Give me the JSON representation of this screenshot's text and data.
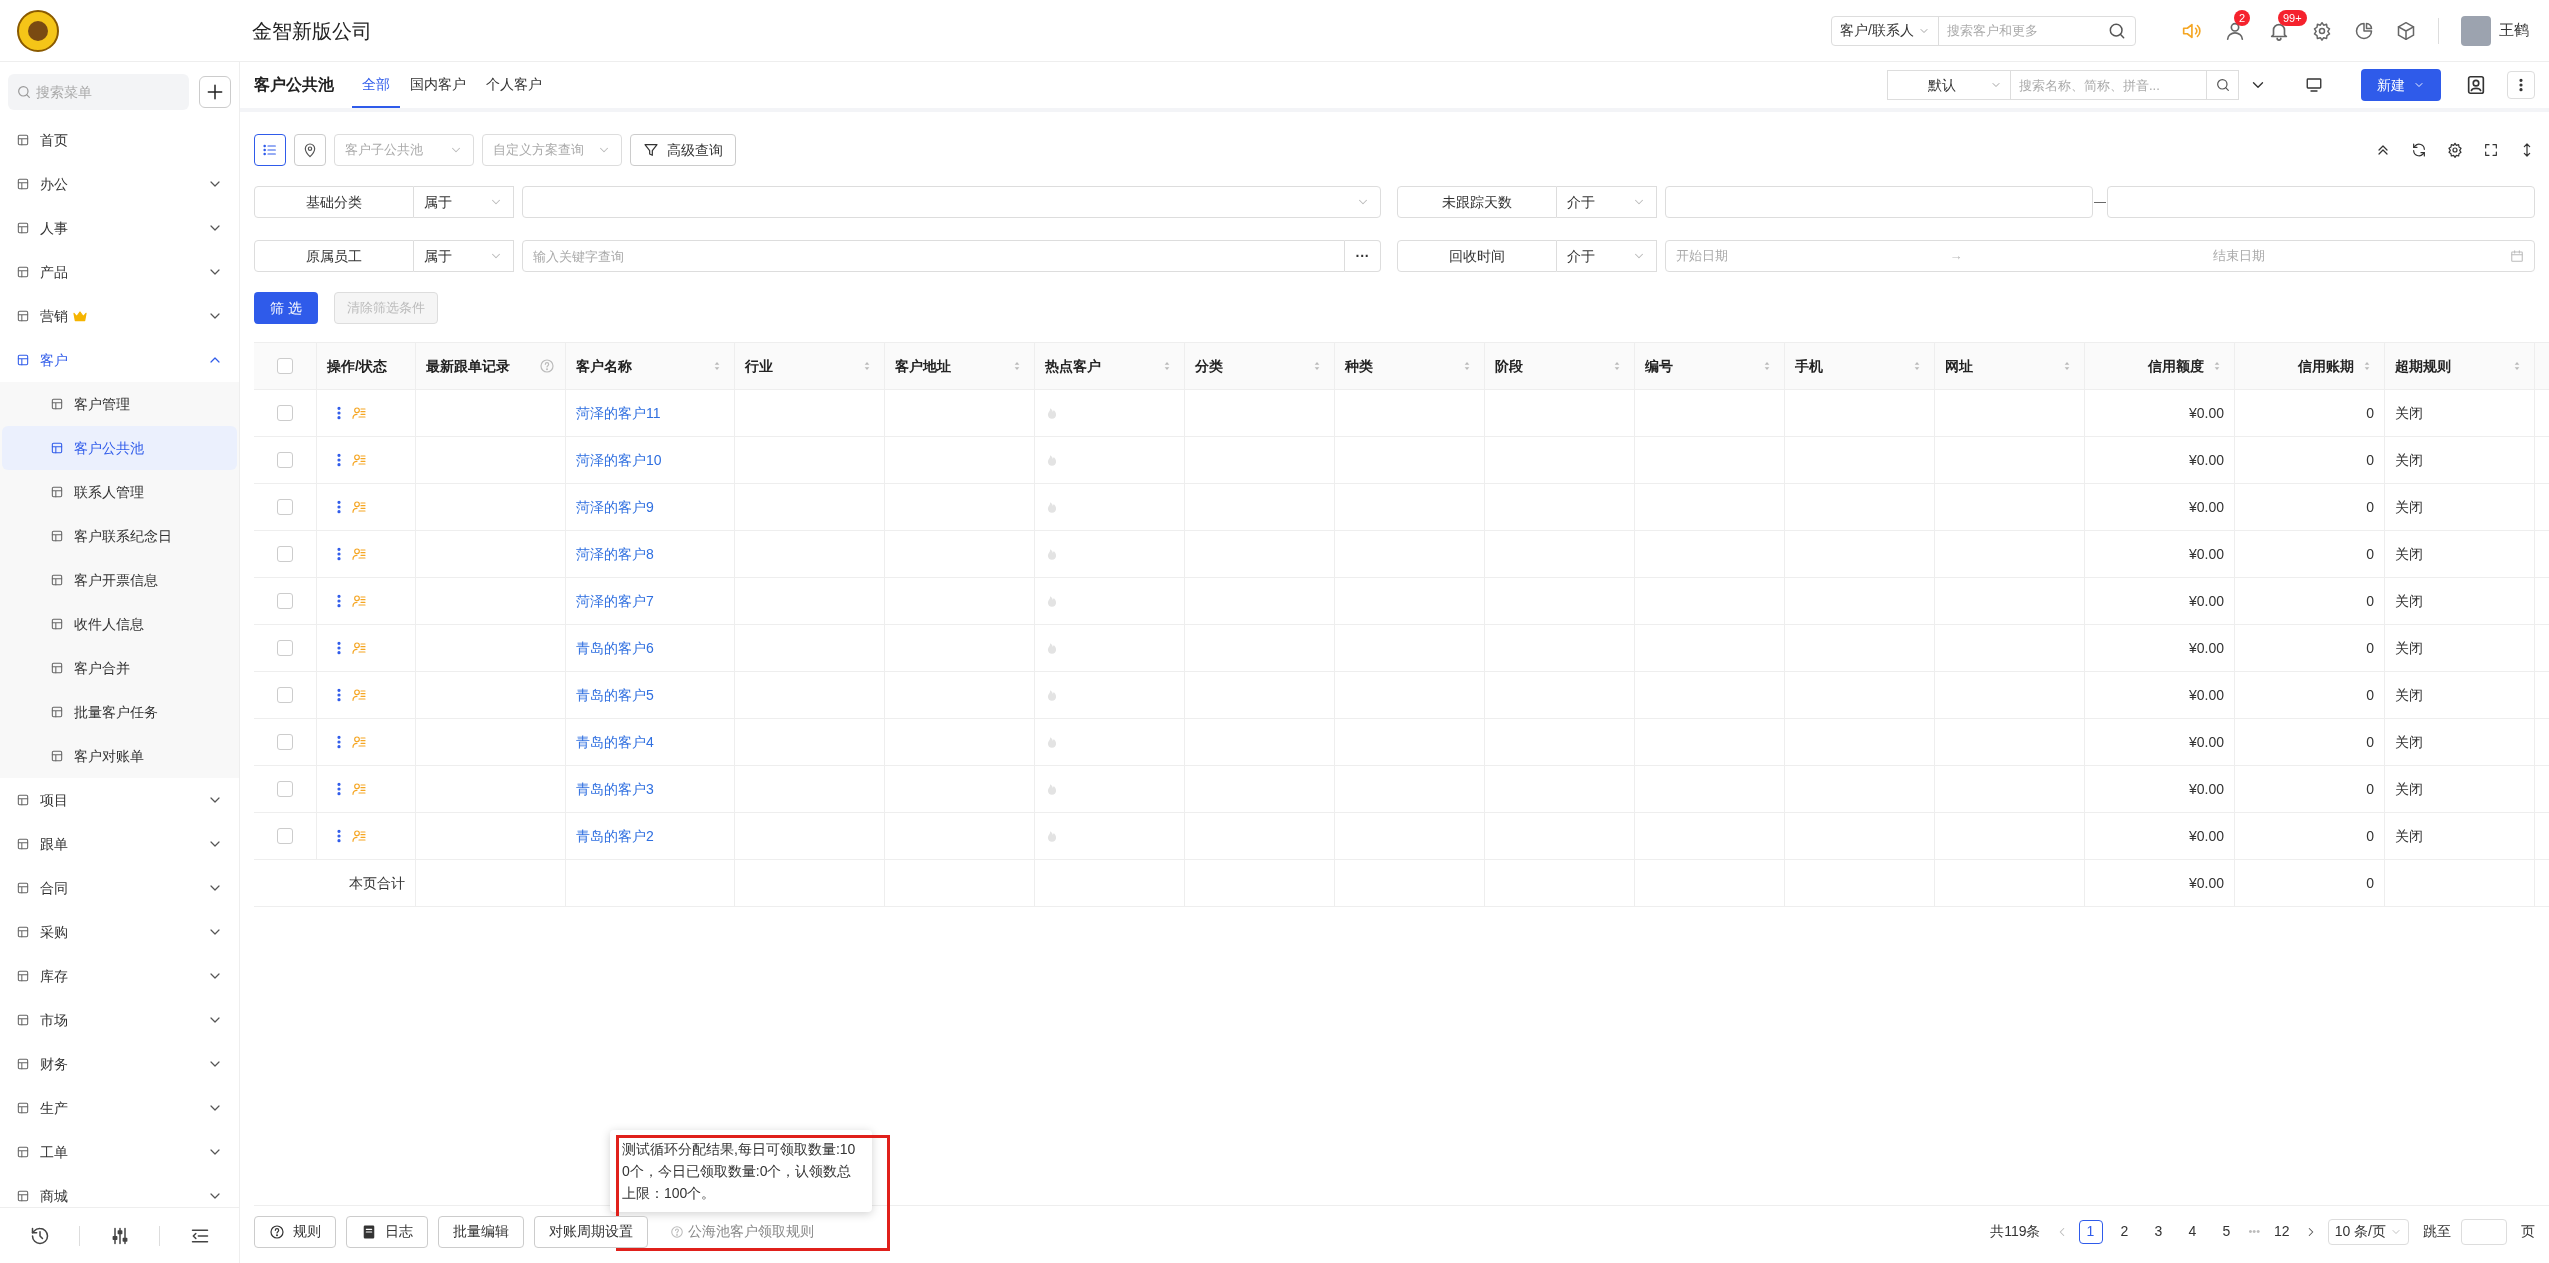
{
  "header": {
    "company": "金智新版公司",
    "search_scope": "客户/联系人",
    "search_placeholder": "搜索客户和更多",
    "user_badge": "2",
    "bell_badge": "99+",
    "user": "王鹤"
  },
  "sidebar": {
    "search_placeholder": "搜索菜单",
    "items": [
      {
        "label": "首页",
        "selected": false
      },
      {
        "label": "办公",
        "selected": false,
        "expanded": false
      },
      {
        "label": "人事",
        "selected": false,
        "expanded": false
      },
      {
        "label": "产品",
        "selected": false,
        "expanded": false
      },
      {
        "label": "营销",
        "selected": false,
        "expanded": false,
        "crown": true
      },
      {
        "label": "客户",
        "selected": true,
        "expanded": true,
        "children": [
          {
            "label": "客户管理",
            "selected": false
          },
          {
            "label": "客户公共池",
            "selected": true
          },
          {
            "label": "联系人管理",
            "selected": false
          },
          {
            "label": "客户联系纪念日",
            "selected": false
          },
          {
            "label": "客户开票信息",
            "selected": false
          },
          {
            "label": "收件人信息",
            "selected": false
          },
          {
            "label": "客户合并",
            "selected": false
          },
          {
            "label": "批量客户任务",
            "selected": false
          },
          {
            "label": "客户对账单",
            "selected": false
          }
        ]
      },
      {
        "label": "项目",
        "selected": false,
        "expanded": false
      },
      {
        "label": "跟单",
        "selected": false,
        "expanded": false
      },
      {
        "label": "合同",
        "selected": false,
        "expanded": false
      },
      {
        "label": "采购",
        "selected": false,
        "expanded": false
      },
      {
        "label": "库存",
        "selected": false,
        "expanded": false
      },
      {
        "label": "市场",
        "selected": false,
        "expanded": false
      },
      {
        "label": "财务",
        "selected": false,
        "expanded": false
      },
      {
        "label": "生产",
        "selected": false,
        "expanded": false
      },
      {
        "label": "工单",
        "selected": false,
        "expanded": false
      },
      {
        "label": "商城",
        "selected": false,
        "expanded": false
      }
    ]
  },
  "page": {
    "title": "客户公共池",
    "tabs": [
      {
        "label": "全部",
        "selected": true
      },
      {
        "label": "国内客户",
        "selected": false
      },
      {
        "label": "个人客户",
        "selected": false
      }
    ],
    "view_select": "默认",
    "search_placeholder": "搜索名称、简称、拼音...",
    "new_button": "新建"
  },
  "toolbar": {
    "views": [
      {
        "kind": "list",
        "selected": true
      },
      {
        "kind": "map",
        "selected": false
      }
    ],
    "pool_select": "客户子公共池",
    "scheme_select": "自定义方案查询",
    "advanced": "高级查询"
  },
  "filters": [
    [
      {
        "label": "基础分类",
        "operator": "属于",
        "kind": "select"
      },
      {
        "label": "未跟踪天数",
        "operator": "介于",
        "kind": "range",
        "separator": "—"
      }
    ],
    [
      {
        "label": "原属员工",
        "operator": "属于",
        "kind": "text",
        "placeholder": "输入关键字查询",
        "more": "···"
      },
      {
        "label": "回收时间",
        "operator": "介于",
        "kind": "date_range",
        "start_placeholder": "开始日期",
        "separator": "→",
        "end_placeholder": "结束日期"
      }
    ]
  ],
  "filter_buttons": {
    "apply": "筛 选",
    "clear": "清除筛选条件"
  },
  "table": {
    "all_checked": false,
    "columns": [
      {
        "label": "操作/状态",
        "sortable": false
      },
      {
        "label": "最新跟单记录",
        "sortable": false,
        "help": true
      },
      {
        "label": "客户名称",
        "sortable": true
      },
      {
        "label": "行业",
        "sortable": true
      },
      {
        "label": "客户地址",
        "sortable": true
      },
      {
        "label": "热点客户",
        "sortable": true
      },
      {
        "label": "分类",
        "sortable": true
      },
      {
        "label": "种类",
        "sortable": true
      },
      {
        "label": "阶段",
        "sortable": true
      },
      {
        "label": "编号",
        "sortable": true
      },
      {
        "label": "手机",
        "sortable": true
      },
      {
        "label": "网址",
        "sortable": true
      },
      {
        "label": "信用额度",
        "sortable": true
      },
      {
        "label": "信用账期",
        "sortable": true
      },
      {
        "label": "超期规则",
        "sortable": true
      }
    ],
    "rows": [
      {
        "checked": false,
        "name": "菏泽的客户11",
        "hot": false,
        "credit_limit": "¥0.00",
        "credit_days": "0",
        "overdue_rule": "关闭"
      },
      {
        "checked": false,
        "name": "菏泽的客户10",
        "hot": false,
        "credit_limit": "¥0.00",
        "credit_days": "0",
        "overdue_rule": "关闭"
      },
      {
        "checked": false,
        "name": "菏泽的客户9",
        "hot": false,
        "credit_limit": "¥0.00",
        "credit_days": "0",
        "overdue_rule": "关闭"
      },
      {
        "checked": false,
        "name": "菏泽的客户8",
        "hot": false,
        "credit_limit": "¥0.00",
        "credit_days": "0",
        "overdue_rule": "关闭"
      },
      {
        "checked": false,
        "name": "菏泽的客户7",
        "hot": false,
        "credit_limit": "¥0.00",
        "credit_days": "0",
        "overdue_rule": "关闭"
      },
      {
        "checked": false,
        "name": "青岛的客户6",
        "hot": false,
        "credit_limit": "¥0.00",
        "credit_days": "0",
        "overdue_rule": "关闭"
      },
      {
        "checked": false,
        "name": "青岛的客户5",
        "hot": false,
        "credit_limit": "¥0.00",
        "credit_days": "0",
        "overdue_rule": "关闭"
      },
      {
        "checked": false,
        "name": "青岛的客户4",
        "hot": false,
        "credit_limit": "¥0.00",
        "credit_days": "0",
        "overdue_rule": "关闭"
      },
      {
        "checked": false,
        "name": "青岛的客户3",
        "hot": false,
        "credit_limit": "¥0.00",
        "credit_days": "0",
        "overdue_rule": "关闭"
      },
      {
        "checked": false,
        "name": "青岛的客户2",
        "hot": false,
        "credit_limit": "¥0.00",
        "credit_days": "0",
        "overdue_rule": "关闭"
      }
    ],
    "summary": {
      "label": "本页合计",
      "credit_limit": "¥0.00",
      "credit_days": "0"
    }
  },
  "footer": {
    "buttons": [
      {
        "label": "规则"
      },
      {
        "label": "日志"
      },
      {
        "label": "批量编辑"
      },
      {
        "label": "对账周期设置"
      }
    ],
    "rule_link": "公海池客户领取规则",
    "tooltip": "测试循环分配结果,每日可领取数量:100个，今日已领取数量:0个，认领数总上限：100个。",
    "highlight": true,
    "pagination": {
      "total": "共119条",
      "pages": [
        {
          "label": "1",
          "selected": true
        },
        {
          "label": "2",
          "selected": false
        },
        {
          "label": "3",
          "selected": false
        },
        {
          "label": "4",
          "selected": false
        },
        {
          "label": "5",
          "selected": false
        }
      ],
      "ellipsis": "•••",
      "last": "12",
      "page_size": "10 条/页",
      "jump_label": "跳至",
      "page_unit": "页"
    }
  }
}
